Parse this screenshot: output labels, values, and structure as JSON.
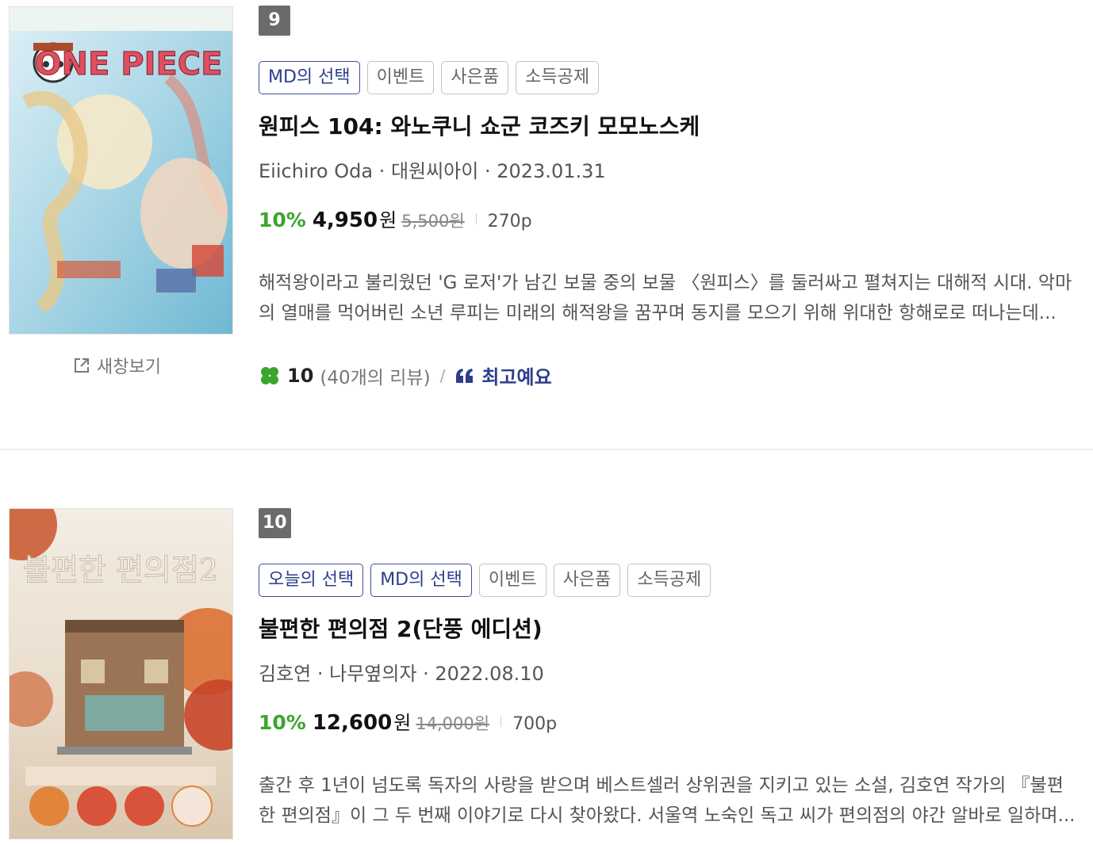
{
  "items": [
    {
      "rank": "9",
      "tags": [
        "MD의 선택",
        "이벤트",
        "사은품",
        "소득공제"
      ],
      "title": "원피스 104: 와노쿠니 쇼군 코즈키 모모노스케",
      "meta": "Eiichiro Oda · 대원씨아이 · 2023.01.31",
      "discount": "10%",
      "sale_price": "4,950",
      "won": "원",
      "original_price": "5,500원",
      "pages": "270p",
      "description": "해적왕이라고 불리웠던 'G 로저'가 남긴 보물 중의 보물 〈원피스〉를 둘러싸고 펼쳐지는 대해적 시대. 악마의 열매를 먹어버린 소년 루피는 미래의 해적왕을 꿈꾸며 동지를 모으기 위해 위대한 항해로로 떠나는데...",
      "rating": "10",
      "review_count": "(40개의 리뷰)",
      "review_tag": "최고예요",
      "new_window": "새창보기",
      "cover_text": "ONE PIECE"
    },
    {
      "rank": "10",
      "tags": [
        "오늘의 선택",
        "MD의 선택",
        "이벤트",
        "사은품",
        "소득공제"
      ],
      "title": "불편한 편의점 2(단풍 에디션)",
      "meta": "김호연 · 나무옆의자 · 2022.08.10",
      "discount": "10%",
      "sale_price": "12,600",
      "won": "원",
      "original_price": "14,000원",
      "pages": "700p",
      "description": "출간 후 1년이 넘도록 독자의 사랑을 받으며 베스트셀러 상위권을 지키고 있는 소설, 김호연 작가의 『불편한 편의점』이 그 두 번째 이야기로 다시 찾아왔다. 서울역 노숙인 독고 씨가 편의점의 야간 알바로 일하며...",
      "cover_text": "불편한 편의점2"
    }
  ],
  "colors": {
    "discount": "#3ba52d",
    "tag_blue": "#2c3e8c",
    "rank_bg": "#6b6b6b",
    "clover": "#3ba52d"
  },
  "icons": {
    "new_window": "external-link-icon",
    "rating": "clover-icon",
    "review": "quote-icon"
  }
}
